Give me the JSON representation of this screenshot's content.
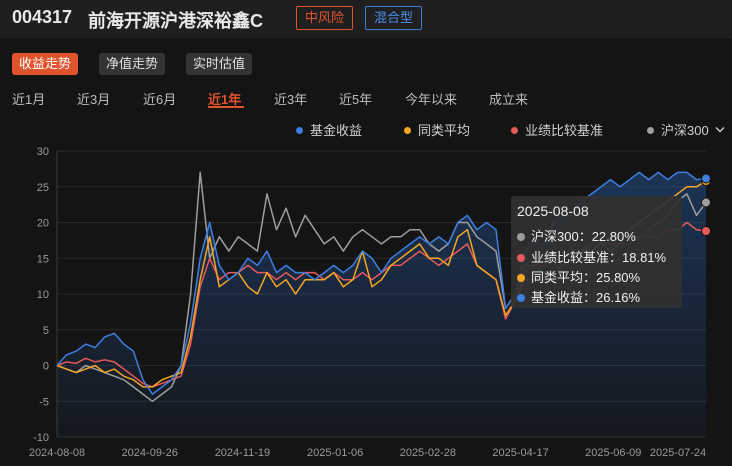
{
  "header": {
    "fund_code": "004317",
    "fund_name": "前海开源沪港深裕鑫C",
    "risk_tag": "中风险",
    "type_tag": "混合型"
  },
  "view_buttons": [
    {
      "label": "收益走势",
      "active": true
    },
    {
      "label": "净值走势",
      "active": false
    },
    {
      "label": "实时估值",
      "active": false
    }
  ],
  "periods": [
    {
      "label": "近1月",
      "active": false
    },
    {
      "label": "近3月",
      "active": false
    },
    {
      "label": "近6月",
      "active": false
    },
    {
      "label": "近1年",
      "active": true
    },
    {
      "label": "近3年",
      "active": false
    },
    {
      "label": "近5年",
      "active": false
    },
    {
      "label": "今年以来",
      "active": false
    },
    {
      "label": "成立来",
      "active": false
    }
  ],
  "legend": {
    "fund": "基金收益",
    "peer": "同类平均",
    "benchmark": "业绩比较基准",
    "index": "沪深300",
    "dropdown_icon": "chevron-down-icon"
  },
  "colors": {
    "fund": "#3d7fe0",
    "peer": "#f5a623",
    "benchmark": "#e85a5a",
    "index": "#9e9e9e",
    "accent": "#e0542d"
  },
  "tooltip": {
    "date": "2025-08-08",
    "rows": [
      {
        "label": "沪深300：22.80%",
        "color": "#9e9e9e"
      },
      {
        "label": "业绩比较基准：18.81%",
        "color": "#e85a5a"
      },
      {
        "label": "同类平均：25.80%",
        "color": "#f5a623"
      },
      {
        "label": "基金收益：26.16%",
        "color": "#3d7fe0"
      }
    ]
  },
  "chart_data": {
    "type": "line",
    "ylim": [
      -10,
      30
    ],
    "yticks": [
      "30",
      "25",
      "20",
      "15",
      "10",
      "5",
      "0",
      "-5",
      "-10"
    ],
    "xticks": [
      "2024-08-08",
      "2024-09-26",
      "2024-11-19",
      "2025-01-06",
      "2025-02-28",
      "2025-04-17",
      "2025-06-09",
      "2025-07-24"
    ],
    "series": [
      {
        "name": "基金收益",
        "key": "fund",
        "values": [
          0,
          1.5,
          2,
          3,
          2.5,
          4,
          4.5,
          3,
          2,
          -2,
          -4,
          -3,
          -2,
          0,
          6,
          15,
          20,
          14,
          12,
          13,
          15,
          14,
          16,
          13,
          14,
          13,
          13,
          12,
          13,
          14,
          13,
          14,
          16,
          15,
          13,
          15,
          16,
          17,
          18,
          17,
          18,
          17,
          20,
          21,
          19,
          20,
          19,
          8,
          10,
          16,
          17,
          17,
          20,
          21,
          21,
          23,
          24,
          25,
          26,
          25,
          26,
          27,
          26,
          27,
          26,
          27,
          27,
          26,
          26.16
        ]
      },
      {
        "name": "同类平均",
        "key": "peer",
        "values": [
          0,
          -0.5,
          -1,
          -0.5,
          0,
          -1,
          -0.5,
          -1.5,
          -2,
          -3,
          -3,
          -2,
          -1.5,
          -1,
          4,
          12,
          18,
          11,
          12,
          13,
          11,
          10,
          13,
          11,
          12,
          10,
          12,
          12,
          12,
          13,
          11,
          12,
          16,
          11,
          12,
          14,
          15,
          16,
          17,
          15,
          15,
          14,
          18,
          19,
          14,
          13,
          12,
          7,
          9,
          12,
          12,
          13,
          13,
          14,
          15,
          16,
          16,
          17,
          18,
          18,
          19,
          20,
          21,
          22,
          23,
          24,
          25,
          25,
          25.8
        ]
      },
      {
        "name": "业绩比较基准",
        "key": "benchmark",
        "values": [
          0,
          0.5,
          0.3,
          1,
          0.5,
          0.8,
          0.5,
          -0.5,
          -1.5,
          -2.5,
          -3,
          -2.5,
          -2,
          -1.5,
          3,
          11,
          15,
          12,
          13,
          13,
          14,
          13,
          13,
          12,
          13,
          12,
          13,
          13,
          12,
          13,
          12,
          12,
          13,
          12,
          13,
          14,
          14,
          15,
          16,
          15,
          14,
          15,
          16,
          17,
          14,
          13,
          12,
          6.5,
          9,
          13,
          14,
          14,
          15,
          15,
          16,
          16,
          16,
          17,
          17,
          17,
          17,
          18,
          18,
          18,
          19,
          19,
          20,
          19,
          18.81
        ]
      },
      {
        "name": "沪深300",
        "key": "index",
        "values": [
          0,
          -0.5,
          -1,
          0,
          -0.5,
          -1,
          -1.5,
          -2,
          -3,
          -4,
          -5,
          -4,
          -3,
          0,
          10,
          27,
          15,
          18,
          16,
          18,
          17,
          16,
          24,
          19,
          22,
          18,
          21,
          19,
          17,
          18,
          16,
          18,
          19,
          18,
          17,
          18,
          18,
          19,
          19,
          17,
          16,
          17,
          20,
          20,
          18,
          17,
          16,
          8,
          10,
          14,
          14,
          15,
          15,
          15,
          16,
          16,
          17,
          17,
          16,
          17,
          17,
          18,
          19,
          20,
          21,
          23,
          24,
          21,
          22.8
        ]
      }
    ]
  }
}
